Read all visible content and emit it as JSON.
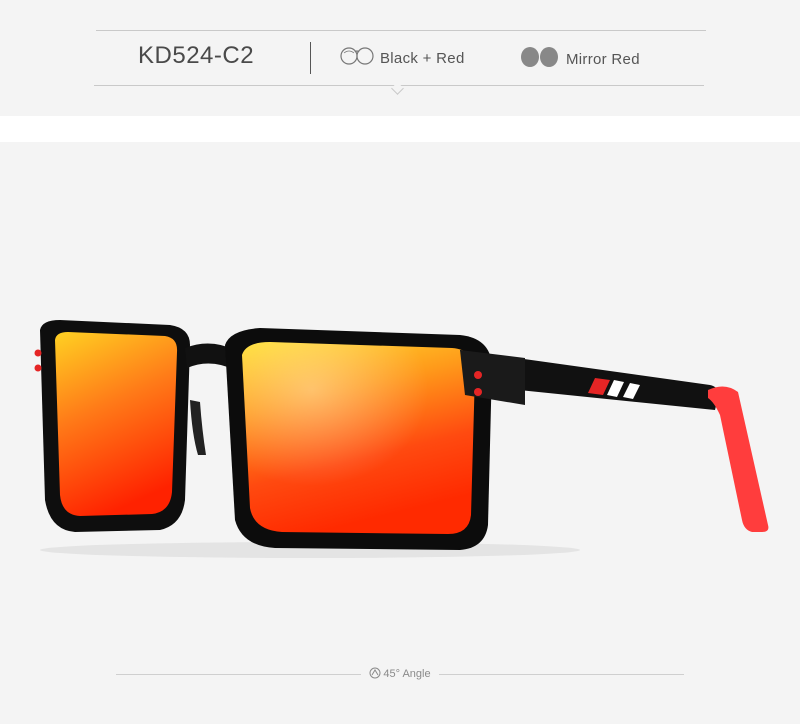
{
  "header": {
    "model_code": "KD524-C2",
    "frame_color_label": "Black + Red",
    "lens_color_label": "Mirror Red",
    "frame_icon": "frame-outline-icon",
    "lens_icon": "lens-filled-icon"
  },
  "product": {
    "image_name": "sunglasses-black-red-mirror-lens",
    "angle_label": "45° Angle",
    "angle_icon": "angle-icon"
  },
  "colors": {
    "band_background": "#f4f4f4",
    "frame": "#111111",
    "temple_tip": "#ff3b3b",
    "lens_top": "#ffd21f",
    "lens_bottom": "#ff2a00"
  }
}
